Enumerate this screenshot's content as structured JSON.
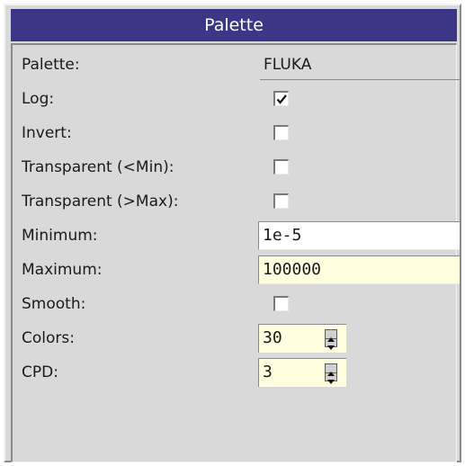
{
  "window": {
    "title": "Palette"
  },
  "rows": {
    "palette": {
      "label": "Palette:",
      "value": "FLUKA"
    },
    "log": {
      "label": "Log:",
      "checked": true
    },
    "invert": {
      "label": "Invert:",
      "checked": false
    },
    "transparent_min": {
      "label": "Transparent (<Min):",
      "checked": false
    },
    "transparent_max": {
      "label": "Transparent (>Max):",
      "checked": false
    },
    "minimum": {
      "label": "Minimum:",
      "value": "1e-5"
    },
    "maximum": {
      "label": "Maximum:",
      "value": "100000"
    },
    "smooth": {
      "label": "Smooth:",
      "checked": false
    },
    "colors": {
      "label": "Colors:",
      "value": "30"
    },
    "cpd": {
      "label": "CPD:",
      "value": "3"
    }
  },
  "colors": {
    "title_bar": "#3c3687",
    "panel_background": "#d9d9d9",
    "field_highlight": "#ffffe0"
  },
  "icons": {
    "check": "check-icon",
    "spin_up": "spin-up-icon",
    "spin_down": "spin-down-icon"
  }
}
